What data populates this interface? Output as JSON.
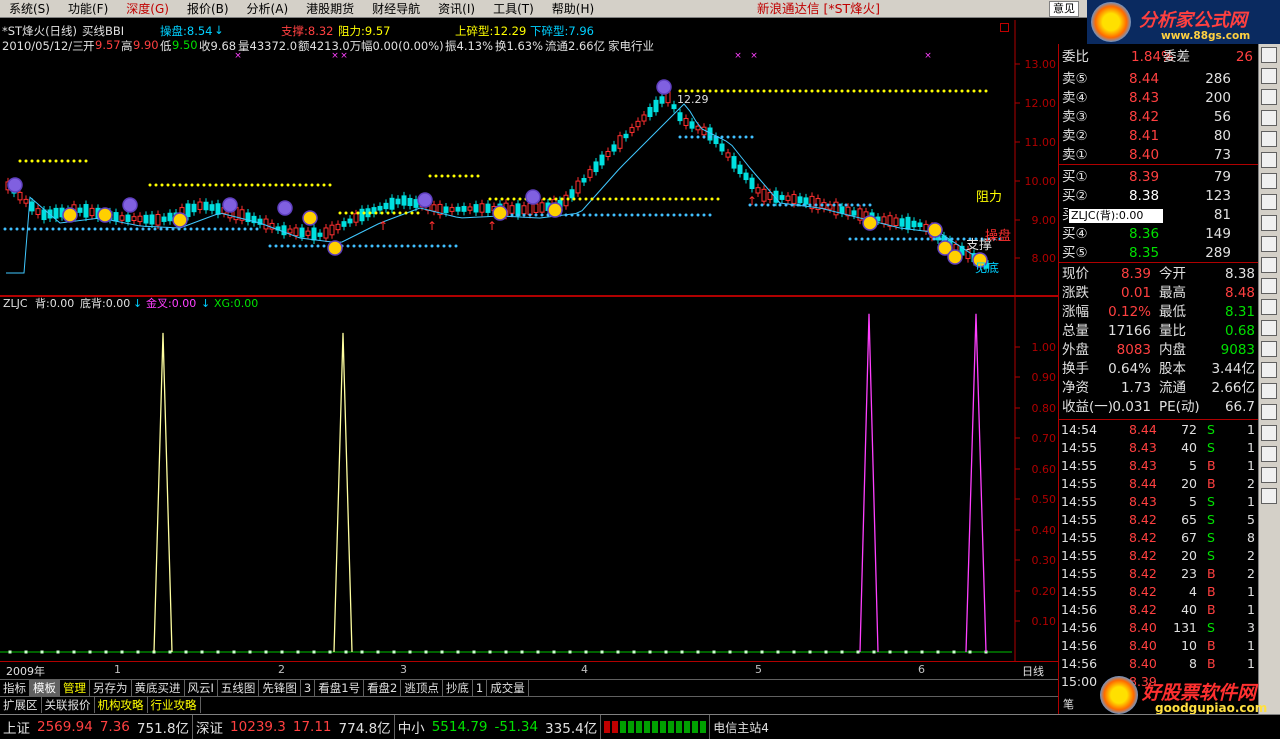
{
  "menu": {
    "items": [
      "系统(S)",
      "功能(F)",
      "深度(G)",
      "报价(B)",
      "分析(A)",
      "港股期货",
      "财经导航",
      "资讯(I)",
      "工具(T)",
      "帮助(H)"
    ],
    "window_title": "新浪通达信 [*ST烽火]",
    "search_box": "意见"
  },
  "logo_top": {
    "title": "分析家公式网",
    "url": "www.88gs.com"
  },
  "header": {
    "stock": "*ST烽火(日线)",
    "indicator": "买线BBI",
    "control": "操盘:8.54",
    "support": "支撑:8.32",
    "resistance": "阻力:9.57",
    "upper": "上碎型:12.29",
    "lower": "下碎型:7.96",
    "date": "2010/05/12/三",
    "open_l": "开",
    "open_v": "9.57",
    "high_l": "高",
    "high_v": "9.90",
    "low_l": "低",
    "low_v": "9.50",
    "close": "收9.68",
    "vol": "量43372.0",
    "amt": "额4213.0万",
    "chg": "幅0.00(0.00%)",
    "amp": "振4.13%",
    "turn": "换1.63%",
    "float": "流通2.66亿",
    "industry": "家电行业"
  },
  "chart_labels": {
    "peak": "12.29",
    "resist": "阻力",
    "support": "支撑",
    "control": "操盘",
    "bottom": "见底"
  },
  "price_axis": [
    "13.00",
    "12.00",
    "11.00",
    "10.00",
    "9.00",
    "8.00"
  ],
  "indicator": {
    "name": "ZLJC",
    "back": "背:0.00",
    "bottom_back": "底背:0.00",
    "golden": "金叉:0.00",
    "xg": "XG:0.00",
    "axis": [
      "1.00",
      "0.90",
      "0.80",
      "0.70",
      "0.60",
      "0.50",
      "0.40",
      "0.30",
      "0.20",
      "0.10"
    ]
  },
  "x_axis": {
    "labels": [
      "2009年",
      "1",
      "2",
      "3",
      "4",
      "5",
      "6"
    ],
    "period": "日线"
  },
  "tabs1": [
    "指标",
    "模板",
    "管理",
    "另存为",
    "黄底买进",
    "风云I",
    "五线图",
    "先锋图",
    "3",
    "看盘1号",
    "看盘2",
    "逃顶点",
    "抄底",
    "1",
    "成交量"
  ],
  "tabs2": [
    "扩展区",
    "关联报价",
    "机构攻略",
    "行业攻略"
  ],
  "right": {
    "weibi_l": "委比",
    "weibi_v": "1.84%",
    "weicha_l": "委差",
    "weicha_v": "26",
    "sell": [
      {
        "label": "卖⑤",
        "price": "8.44",
        "vol": "286"
      },
      {
        "label": "卖④",
        "price": "8.43",
        "vol": "200"
      },
      {
        "label": "卖③",
        "price": "8.42",
        "vol": "56"
      },
      {
        "label": "卖②",
        "price": "8.41",
        "vol": "80"
      },
      {
        "label": "卖①",
        "price": "8.40",
        "vol": "73"
      }
    ],
    "buy": [
      {
        "label": "买①",
        "price": "8.39",
        "vol": "79"
      },
      {
        "label": "买②",
        "price": "8.38",
        "vol": "123"
      },
      {
        "label": "买③",
        "price": "8.37",
        "vol": "81"
      },
      {
        "label": "买④",
        "price": "8.36",
        "vol": "149"
      },
      {
        "label": "买⑤",
        "price": "8.35",
        "vol": "289"
      }
    ],
    "stats": [
      {
        "l1": "现价",
        "v1": "8.39",
        "l2": "今开",
        "v2": "8.38"
      },
      {
        "l1": "涨跌",
        "v1": "0.01",
        "l2": "最高",
        "v2": "8.48"
      },
      {
        "l1": "涨幅",
        "v1": "0.12%",
        "l2": "最低",
        "v2": "8.31"
      },
      {
        "l1": "总量",
        "v1": "17166",
        "l2": "量比",
        "v2": "0.68"
      },
      {
        "l1": "外盘",
        "v1": "8083",
        "l2": "内盘",
        "v2": "9083"
      },
      {
        "l1": "换手",
        "v1": "0.64%",
        "l2": "股本",
        "v2": "3.44亿"
      },
      {
        "l1": "净资",
        "v1": "1.73",
        "l2": "流通",
        "v2": "2.66亿"
      },
      {
        "l1": "收益(一)",
        "v1": "0.031",
        "l2": "PE(动)",
        "v2": "66.7"
      }
    ],
    "ticks": [
      {
        "t": "14:54",
        "p": "8.44",
        "v": "72",
        "s": "S",
        "n": "1"
      },
      {
        "t": "14:55",
        "p": "8.43",
        "v": "40",
        "s": "S",
        "n": "1"
      },
      {
        "t": "14:55",
        "p": "8.43",
        "v": "5",
        "s": "B",
        "n": "1"
      },
      {
        "t": "14:55",
        "p": "8.44",
        "v": "20",
        "s": "B",
        "n": "2"
      },
      {
        "t": "14:55",
        "p": "8.43",
        "v": "5",
        "s": "S",
        "n": "1"
      },
      {
        "t": "14:55",
        "p": "8.42",
        "v": "65",
        "s": "S",
        "n": "5"
      },
      {
        "t": "14:55",
        "p": "8.42",
        "v": "67",
        "s": "S",
        "n": "8"
      },
      {
        "t": "14:55",
        "p": "8.42",
        "v": "20",
        "s": "S",
        "n": "2"
      },
      {
        "t": "14:55",
        "p": "8.42",
        "v": "23",
        "s": "B",
        "n": "2"
      },
      {
        "t": "14:55",
        "p": "8.42",
        "v": "4",
        "s": "B",
        "n": "1"
      },
      {
        "t": "14:56",
        "p": "8.42",
        "v": "40",
        "s": "B",
        "n": "1"
      },
      {
        "t": "14:56",
        "p": "8.40",
        "v": "131",
        "s": "S",
        "n": "3"
      },
      {
        "t": "14:56",
        "p": "8.40",
        "v": "10",
        "s": "B",
        "n": "1"
      },
      {
        "t": "14:56",
        "p": "8.40",
        "v": "8",
        "s": "B",
        "n": "1"
      },
      {
        "t": "15:00",
        "p": "8.39",
        "v": "",
        "s": "",
        "n": ""
      }
    ],
    "tooltip": "ZLJC(背):0.00",
    "tab_label": "笔"
  },
  "logo_bottom": {
    "title": "好股票软件网",
    "url": "goodgupiao.com"
  },
  "status": [
    {
      "name": "上证",
      "price": "2569.94",
      "chg": "7.36",
      "amt": "751.8亿"
    },
    {
      "name": "深证",
      "price": "10239.3",
      "chg": "17.11",
      "amt": "774.8亿"
    },
    {
      "name": "中小",
      "price": "5514.79",
      "chg": "-51.34",
      "amt": "335.4亿"
    }
  ],
  "status_server": "电信主站4",
  "chart_data": {
    "type": "line",
    "series": [
      {
        "values": [
          0.0,
          1.0,
          0.0,
          1.0,
          0.0,
          1.0,
          0.0,
          1.0,
          0.0
        ]
      }
    ],
    "ylim": [
      0,
      1.1
    ]
  }
}
